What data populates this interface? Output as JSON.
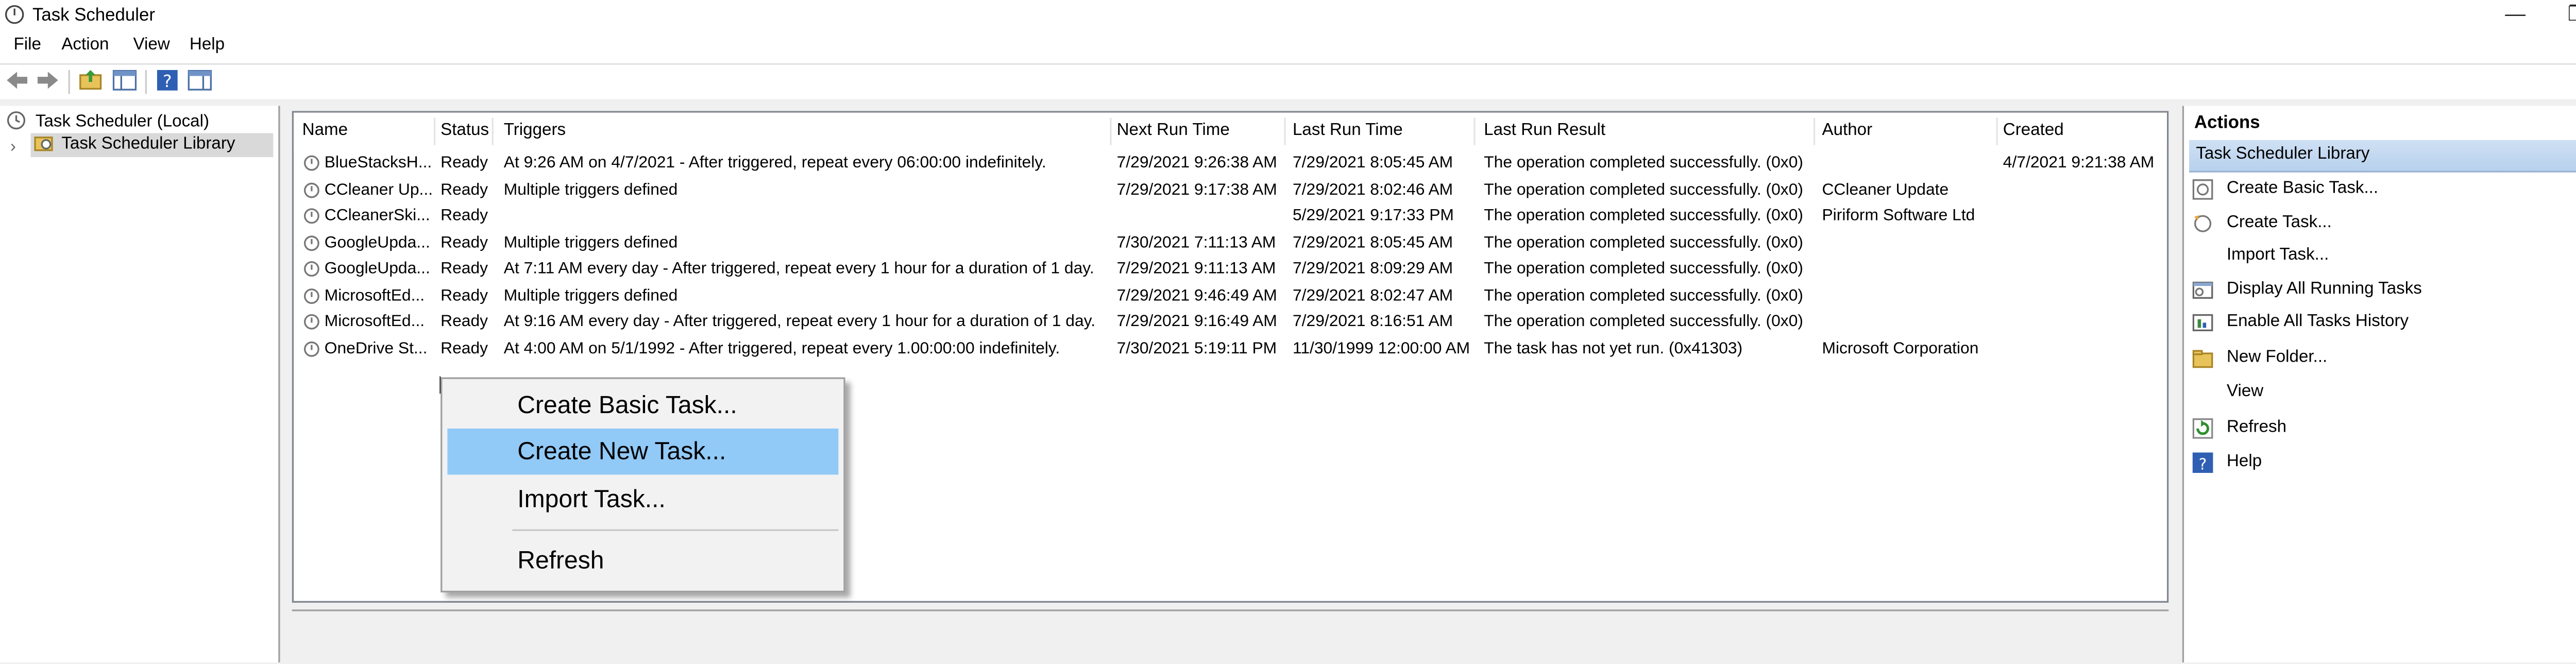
{
  "window": {
    "title": "Task Scheduler",
    "controls": [
      "—",
      "❐",
      "✕"
    ]
  },
  "menu": [
    "File",
    "Action",
    "View",
    "Help"
  ],
  "tree": [
    {
      "label": "Task Scheduler (Local)"
    },
    {
      "label": "Task Scheduler Library",
      "expander": "›"
    }
  ],
  "table": {
    "headers": [
      "Name",
      "Status",
      "Triggers",
      "Next Run Time",
      "Last Run Time",
      "Last Run Result",
      "Author",
      "Created"
    ],
    "rows": [
      [
        "BlueStacksH...",
        "Ready",
        "At 9:26 AM on 4/7/2021 - After triggered, repeat every 06:00:00 indefinitely.",
        "7/29/2021 9:26:38 AM",
        "7/29/2021 8:05:45 AM",
        "The operation completed successfully. (0x0)",
        "",
        "4/7/2021 9:21:38 AM"
      ],
      [
        "CCleaner Up...",
        "Ready",
        "Multiple triggers defined",
        "7/29/2021 9:17:38 AM",
        "7/29/2021 8:02:46 AM",
        "The operation completed successfully. (0x0)",
        "CCleaner Update",
        ""
      ],
      [
        "CCleanerSki...",
        "Ready",
        "",
        "",
        "5/29/2021 9:17:33 PM",
        "The operation completed successfully. (0x0)",
        "Piriform Software Ltd",
        ""
      ],
      [
        "GoogleUpda...",
        "Ready",
        "Multiple triggers defined",
        "7/30/2021 7:11:13 AM",
        "7/29/2021 8:05:45 AM",
        "The operation completed successfully. (0x0)",
        "",
        ""
      ],
      [
        "GoogleUpda...",
        "Ready",
        "At 7:11 AM every day - After triggered, repeat every 1 hour for a duration of 1 day.",
        "7/29/2021 9:11:13 AM",
        "7/29/2021 8:09:29 AM",
        "The operation completed successfully. (0x0)",
        "",
        ""
      ],
      [
        "MicrosoftEd...",
        "Ready",
        "Multiple triggers defined",
        "7/29/2021 9:46:49 AM",
        "7/29/2021 8:02:47 AM",
        "The operation completed successfully. (0x0)",
        "",
        ""
      ],
      [
        "MicrosoftEd...",
        "Ready",
        "At 9:16 AM every day - After triggered, repeat every 1 hour for a duration of 1 day.",
        "7/29/2021 9:16:49 AM",
        "7/29/2021 8:16:51 AM",
        "The operation completed successfully. (0x0)",
        "",
        ""
      ],
      [
        "OneDrive St...",
        "Ready",
        "At 4:00 AM on 5/1/1992 - After triggered, repeat every 1.00:00:00 indefinitely.",
        "7/30/2021 5:19:11 PM",
        "11/30/1999 12:00:00 AM",
        "The task has not yet run. (0x41303)",
        "Microsoft Corporation",
        ""
      ]
    ]
  },
  "actions": {
    "title": "Actions",
    "section": "Task Scheduler Library",
    "collapse_glyph": "▲",
    "submenu_glyph": "▶",
    "items": [
      "Create Basic Task...",
      "Create Task...",
      "Import Task...",
      "Display All Running Tasks",
      "Enable All Tasks History",
      "New Folder...",
      "View",
      "Refresh",
      "Help"
    ]
  },
  "context_menu": {
    "items": [
      "Create Basic Task...",
      "Create New Task...",
      "Import Task...",
      "Refresh"
    ],
    "highlighted_index": 1
  },
  "colors": {
    "selection": "#91c9f7",
    "section_header": "#cfe0f3"
  }
}
